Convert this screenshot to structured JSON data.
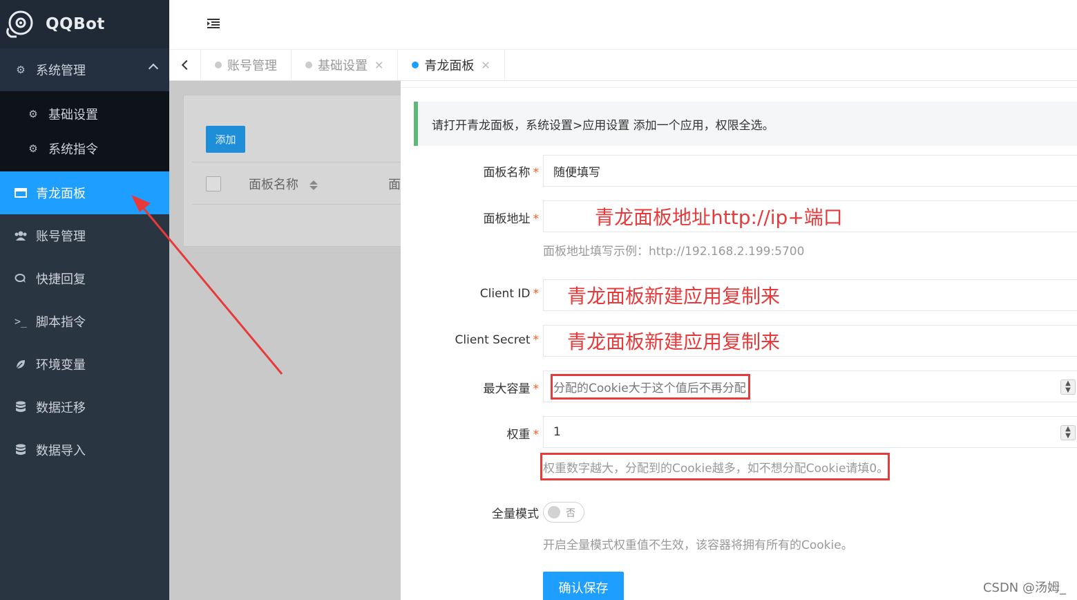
{
  "app": {
    "title": "QQBot"
  },
  "sidebar": {
    "group": {
      "label": "系统管理",
      "icon": "gear-icon"
    },
    "sub_items": [
      {
        "label": "基础设置",
        "icon": "gear-icon"
      },
      {
        "label": "系统指令",
        "icon": "gear-icon"
      }
    ],
    "items": [
      {
        "label": "青龙面板",
        "icon": "window-icon",
        "active": true
      },
      {
        "label": "账号管理",
        "icon": "users-icon"
      },
      {
        "label": "快捷回复",
        "icon": "chat-icon"
      },
      {
        "label": "脚本指令",
        "icon": "terminal-icon"
      },
      {
        "label": "环境变量",
        "icon": "leaf-icon"
      },
      {
        "label": "数据迁移",
        "icon": "database-icon"
      },
      {
        "label": "数据导入",
        "icon": "database-icon"
      }
    ]
  },
  "tabs": [
    {
      "label": "账号管理",
      "closable": false
    },
    {
      "label": "基础设置",
      "closable": true
    },
    {
      "label": "青龙面板",
      "closable": true,
      "active": true
    }
  ],
  "list": {
    "add_button": "添加",
    "columns": [
      "面板名称",
      "面板地址"
    ]
  },
  "form": {
    "notice": "请打开青龙面板，系统设置>应用设置 添加一个应用，权限全选。",
    "fields": {
      "name": {
        "label": "面板名称",
        "value": "随便填写"
      },
      "address": {
        "label": "面板地址",
        "value": "青龙面板地址http://ip+端口",
        "hint": "面板地址填写示例：http://192.168.2.199:5700"
      },
      "client_id": {
        "label": "Client ID",
        "value": "青龙面板新建应用复制来"
      },
      "client_secret": {
        "label": "Client Secret",
        "value": "青龙面板新建应用复制来"
      },
      "capacity": {
        "label": "最大容量",
        "placeholder": "分配的Cookie大于这个值后不再分配"
      },
      "weight": {
        "label": "权重",
        "value": "1",
        "hint": "权重数字越大，分配到的Cookie越多，如不想分配Cookie请填0。"
      },
      "full_mode": {
        "label": "全量模式",
        "switch_label": "否",
        "hint": "开启全量模式权重值不生效，该容器将拥有所有的Cookie。"
      }
    },
    "save_button": "确认保存",
    "required_mark": "*"
  },
  "watermark": "CSDN @汤姆_",
  "colors": {
    "accent": "#1e9fff",
    "annotation": "#e83a3a",
    "sidebar": "#2a3542"
  }
}
